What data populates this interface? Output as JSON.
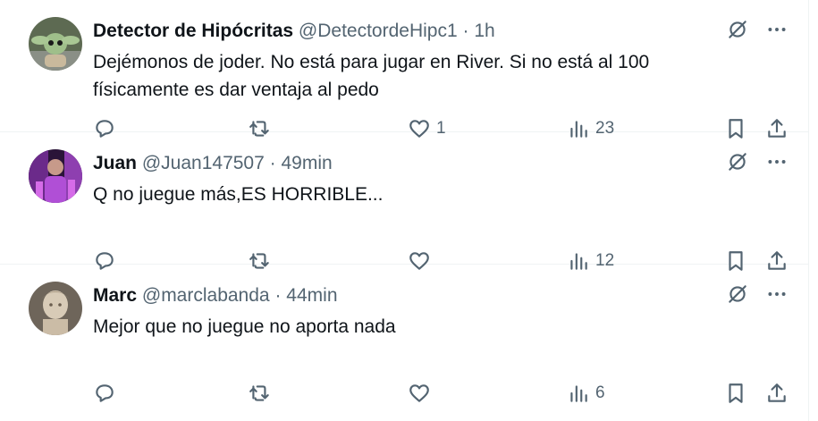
{
  "tweets": [
    {
      "name": "Detector de Hipócritas",
      "handle": "@DetectordeHipc1",
      "separator": "·",
      "time": "1h",
      "text": "Dejémonos de joder. No está para jugar en River. Si no está al 100 físicamente es dar ventaja al pedo",
      "likes": "1",
      "views": "23",
      "avatar_icon": "baby-yoda-avatar"
    },
    {
      "name": "Juan",
      "handle": "@Juan147507",
      "separator": "·",
      "time": "49min",
      "text": "Q no juegue más,ES HORRIBLE...",
      "likes": "",
      "views": "12",
      "avatar_icon": "purple-photo-avatar"
    },
    {
      "name": "Marc",
      "handle": "@marclabanda",
      "separator": "·",
      "time": "44min",
      "text": "Mejor que no juegue no aporta nada",
      "likes": "",
      "views": "6",
      "avatar_icon": "statue-avatar"
    }
  ],
  "icons": {
    "grok": "grok-icon",
    "more": "more-icon",
    "reply": "reply-icon",
    "retweet": "retweet-icon",
    "like": "heart-icon",
    "views": "views-icon",
    "bookmark": "bookmark-icon",
    "share": "share-icon"
  },
  "colors": {
    "text_primary": "#0f1419",
    "text_secondary": "#536471",
    "divider": "#eff3f4"
  }
}
